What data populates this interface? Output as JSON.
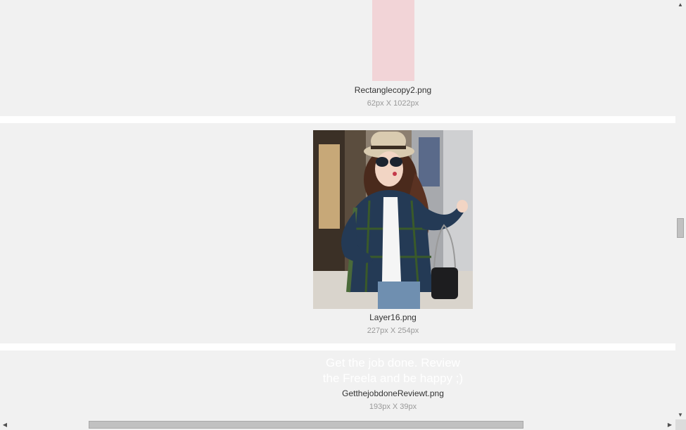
{
  "assets": [
    {
      "file_name": "Rectanglecopy2.png",
      "dimensions": "62px X 1022px",
      "thumb_color": "#f2d4d7"
    },
    {
      "file_name": "Layer16.png",
      "dimensions": "227px X 254px"
    },
    {
      "file_name": "GetthejobdoneReviewt.png",
      "dimensions": "193px X 39px",
      "preview_line1": "Get the job done. Review",
      "preview_line2": "the Freela and be happy ;)"
    }
  ],
  "colors": {
    "background": "#f1f1f1",
    "separator": "#ffffff",
    "scrollbar_thumb": "#c1c1c1"
  },
  "icons": {
    "scroll_up": "scroll-up-arrow-icon",
    "scroll_down": "scroll-down-arrow-icon",
    "scroll_left": "scroll-left-arrow-icon",
    "scroll_right": "scroll-right-arrow-icon"
  }
}
